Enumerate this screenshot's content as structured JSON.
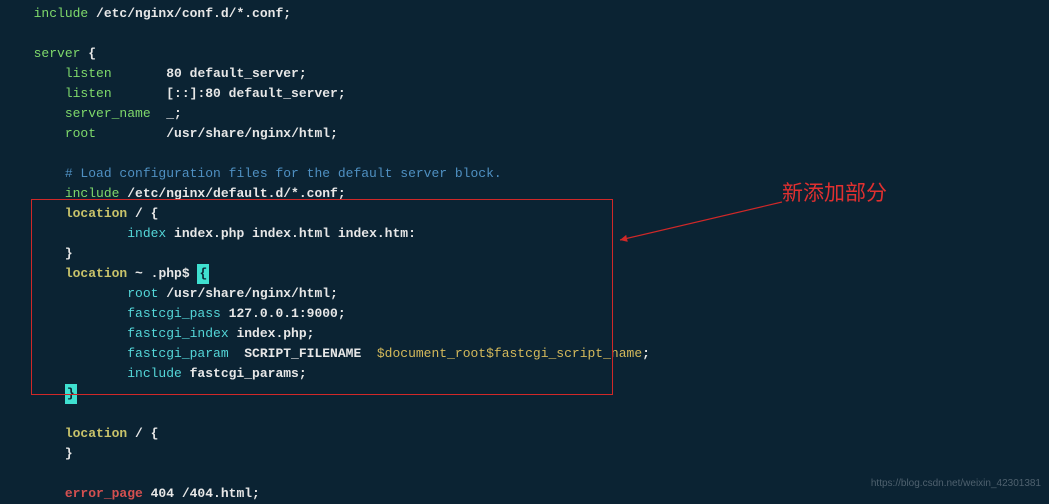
{
  "annotation_label": "新添加部分",
  "watermark": "https://blog.csdn.net/weixin_42301381",
  "lines": [
    {
      "seg": [
        {
          "t": "include",
          "c": "kw-green"
        },
        {
          "t": " /etc/nginx/conf.d/*.conf;",
          "c": "val-white"
        }
      ],
      "indent": 2
    },
    {
      "seg": [],
      "indent": 0
    },
    {
      "seg": [
        {
          "t": "server",
          "c": "kw-green"
        },
        {
          "t": " {",
          "c": "punct"
        }
      ],
      "indent": 2
    },
    {
      "seg": [
        {
          "t": "listen",
          "c": "kw-green"
        },
        {
          "t": "       80 default_server;",
          "c": "val-white"
        }
      ],
      "indent": 6
    },
    {
      "seg": [
        {
          "t": "listen",
          "c": "kw-green"
        },
        {
          "t": "       [::]:80 default_server;",
          "c": "val-white"
        }
      ],
      "indent": 6
    },
    {
      "seg": [
        {
          "t": "server_name",
          "c": "kw-green"
        },
        {
          "t": "  _;",
          "c": "val-white"
        }
      ],
      "indent": 6
    },
    {
      "seg": [
        {
          "t": "root",
          "c": "kw-green"
        },
        {
          "t": "         /usr/share/nginx/html;",
          "c": "val-white"
        }
      ],
      "indent": 6
    },
    {
      "seg": [],
      "indent": 0
    },
    {
      "seg": [
        {
          "t": "# Load configuration files for the default server block.",
          "c": "comment"
        }
      ],
      "indent": 6
    },
    {
      "seg": [
        {
          "t": "include",
          "c": "kw-green"
        },
        {
          "t": " /etc/nginx/default.d/*.conf;",
          "c": "val-white"
        }
      ],
      "indent": 6
    },
    {
      "seg": [
        {
          "t": "location",
          "c": "kw-yellow"
        },
        {
          "t": " / {",
          "c": "punct"
        }
      ],
      "indent": 6
    },
    {
      "seg": [
        {
          "t": "index",
          "c": "dir-teal"
        },
        {
          "t": " index.php index.html index.htm:",
          "c": "val-white"
        }
      ],
      "indent": 14
    },
    {
      "seg": [
        {
          "t": "}",
          "c": "punct"
        }
      ],
      "indent": 6
    },
    {
      "seg": [
        {
          "t": "location",
          "c": "kw-yellow"
        },
        {
          "t": " ~ .php$ ",
          "c": "punct"
        },
        {
          "t": "{",
          "c": "cursor-box"
        }
      ],
      "indent": 6
    },
    {
      "seg": [
        {
          "t": "root",
          "c": "dir-teal"
        },
        {
          "t": " /usr/share/nginx/html;",
          "c": "val-white"
        }
      ],
      "indent": 14
    },
    {
      "seg": [
        {
          "t": "fastcgi_pass",
          "c": "dir-teal"
        },
        {
          "t": " 127.0.0.1:9000;",
          "c": "val-white"
        }
      ],
      "indent": 14
    },
    {
      "seg": [
        {
          "t": "fastcgi_index",
          "c": "dir-teal"
        },
        {
          "t": " index.php;",
          "c": "val-white"
        }
      ],
      "indent": 14
    },
    {
      "seg": [
        {
          "t": "fastcgi_param",
          "c": "dir-teal"
        },
        {
          "t": "  SCRIPT_FILENAME  ",
          "c": "val-white"
        },
        {
          "t": "$document_root$fastcgi_script_name",
          "c": "var-yellow"
        },
        {
          "t": ";",
          "c": "val-white"
        }
      ],
      "indent": 14
    },
    {
      "seg": [
        {
          "t": "include",
          "c": "dir-teal"
        },
        {
          "t": " fastcgi_params;",
          "c": "val-white"
        }
      ],
      "indent": 14
    },
    {
      "seg": [
        {
          "t": "}",
          "c": "cursor-box"
        }
      ],
      "indent": 6
    },
    {
      "seg": [],
      "indent": 0
    },
    {
      "seg": [
        {
          "t": "location",
          "c": "kw-yellow"
        },
        {
          "t": " / {",
          "c": "punct"
        }
      ],
      "indent": 6
    },
    {
      "seg": [
        {
          "t": "}",
          "c": "punct"
        }
      ],
      "indent": 6
    },
    {
      "seg": [],
      "indent": 0
    },
    {
      "seg": [
        {
          "t": "error_page",
          "c": "err-red"
        },
        {
          "t": " 404 /404.html;",
          "c": "val-white"
        }
      ],
      "indent": 6
    }
  ]
}
